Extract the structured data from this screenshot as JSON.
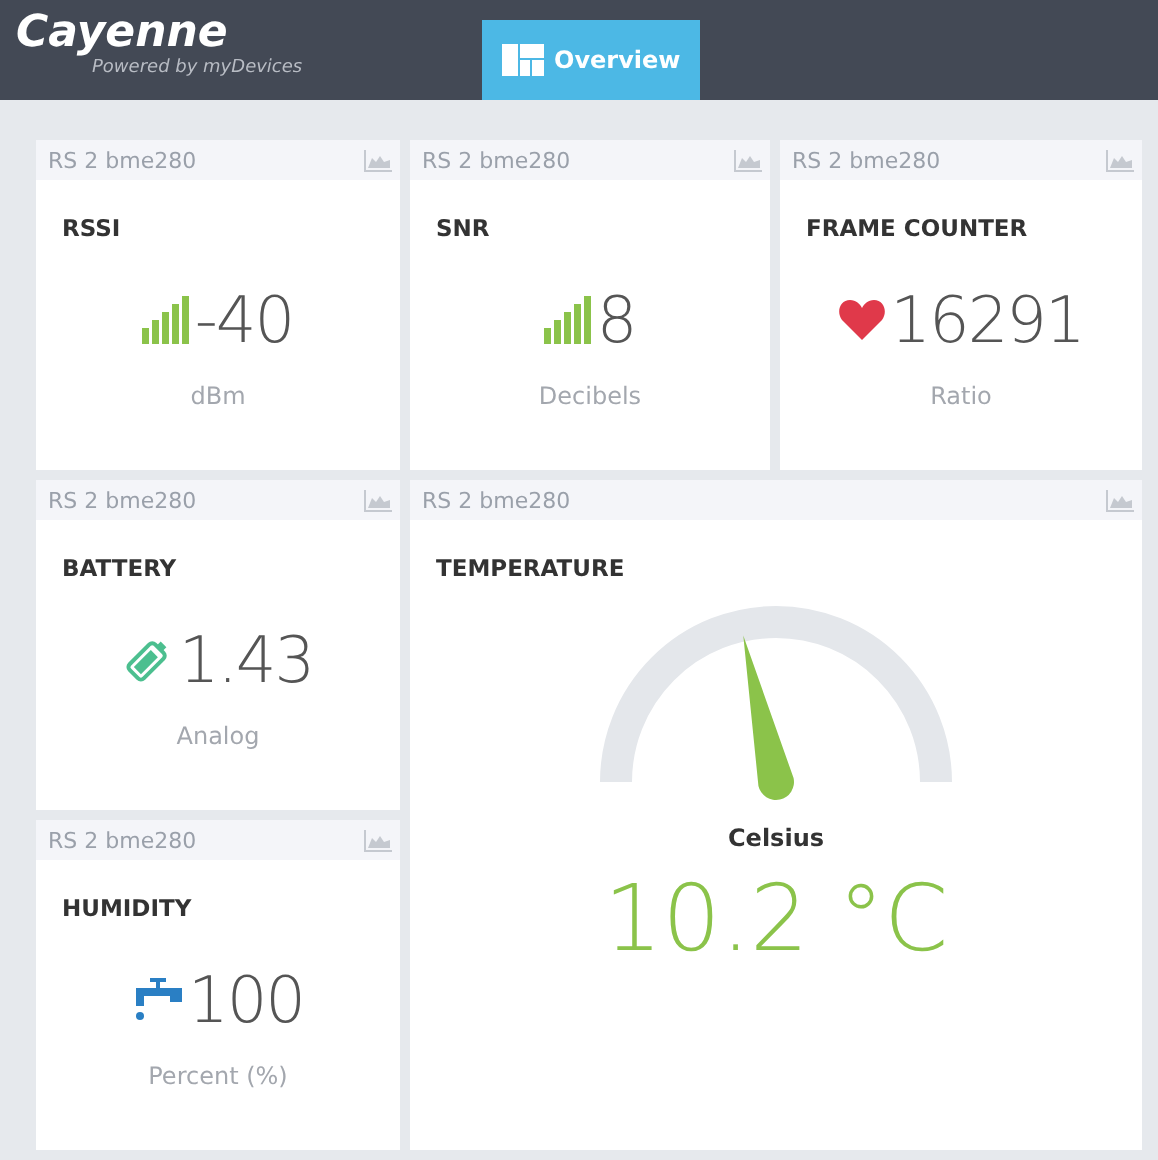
{
  "header": {
    "logo": "Cayenne",
    "tagline": "Powered by myDevices",
    "tabs": [
      {
        "label": "Overview",
        "selected": true
      }
    ]
  },
  "widgets": [
    {
      "kind": "signal",
      "device": "RS 2 bme280",
      "title": "RSSI",
      "value": "-40",
      "unit": "dBm"
    },
    {
      "kind": "signal",
      "device": "RS 2 bme280",
      "title": "SNR",
      "value": "8",
      "unit": "Decibels"
    },
    {
      "kind": "heart",
      "device": "RS 2 bme280",
      "title": "FRAME COUNTER",
      "value": "16291",
      "unit": "Ratio"
    },
    {
      "kind": "battery",
      "device": "RS 2 bme280",
      "title": "BATTERY",
      "value": "1.43",
      "unit": "Analog"
    },
    {
      "kind": "gauge",
      "device": "RS 2 bme280",
      "title": "TEMPERATURE",
      "unit": "Celsius",
      "value": "10.2 °C",
      "level": 0.43
    },
    {
      "kind": "tap",
      "device": "RS 2 bme280",
      "title": "HUMIDITY",
      "value": "100",
      "unit": "Percent (%)"
    }
  ]
}
